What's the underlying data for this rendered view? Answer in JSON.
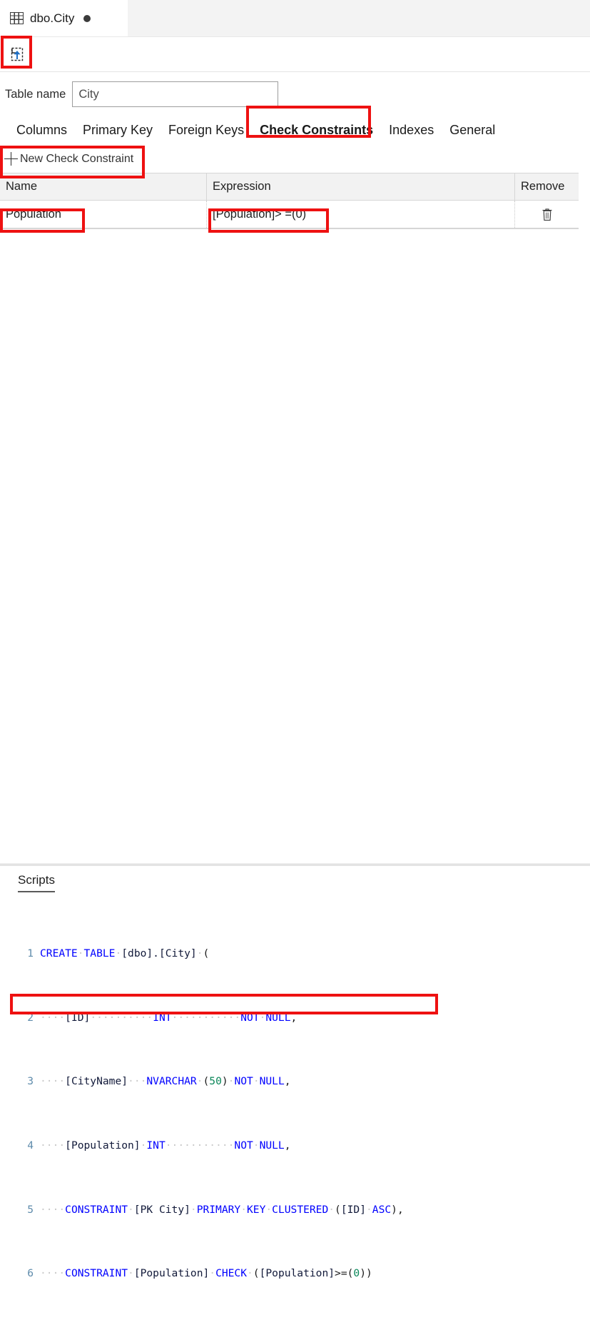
{
  "window": {
    "editor_tab": {
      "icon": "table-grid-icon",
      "title": "dbo.City",
      "dirty_indicator": "●"
    }
  },
  "toolbar": {
    "publish_button": {
      "icon": "publish-update-icon",
      "label": ""
    }
  },
  "table_name": {
    "label": "Table name",
    "value": "City",
    "placeholder": "Table name"
  },
  "designer_tabs": [
    {
      "label": "Columns",
      "active": false
    },
    {
      "label": "Primary Key",
      "active": false
    },
    {
      "label": "Foreign Keys",
      "active": false
    },
    {
      "label": "Check Constraints",
      "active": true
    },
    {
      "label": "Indexes",
      "active": false
    },
    {
      "label": "General",
      "active": false
    }
  ],
  "actions": {
    "new_check_constraint": "New Check Constraint",
    "new_icon": "plus-icon"
  },
  "grid": {
    "columns": [
      "Name",
      "Expression",
      "Remove"
    ],
    "rows": [
      {
        "name": "Population",
        "expression": "[Population]> =(0)",
        "remove_icon": "trash-icon"
      }
    ]
  },
  "scripts": {
    "tab_label": "Scripts",
    "lines": [
      {
        "no": "1",
        "text": "CREATE TABLE [dbo].[City] ("
      },
      {
        "no": "2",
        "text": "    [ID]         INT          NOT NULL,"
      },
      {
        "no": "3",
        "text": "    [CityName]   NVARCHAR (50) NOT NULL,"
      },
      {
        "no": "4",
        "text": "    [Population] INT          NOT NULL,"
      },
      {
        "no": "5",
        "text": "    CONSTRAINT [PK City] PRIMARY KEY CLUSTERED ([ID] ASC),"
      },
      {
        "no": "6",
        "text": "    CONSTRAINT [Population] CHECK ([Population]>=(0))"
      }
    ]
  },
  "annotations": {
    "color": "#ee1111",
    "boxes": [
      "publish-toolbar-button",
      "check-constraints-tab",
      "new-check-constraint-button",
      "constraint-name-cell",
      "constraint-expression-cell",
      "script-check-constraint-line"
    ]
  }
}
